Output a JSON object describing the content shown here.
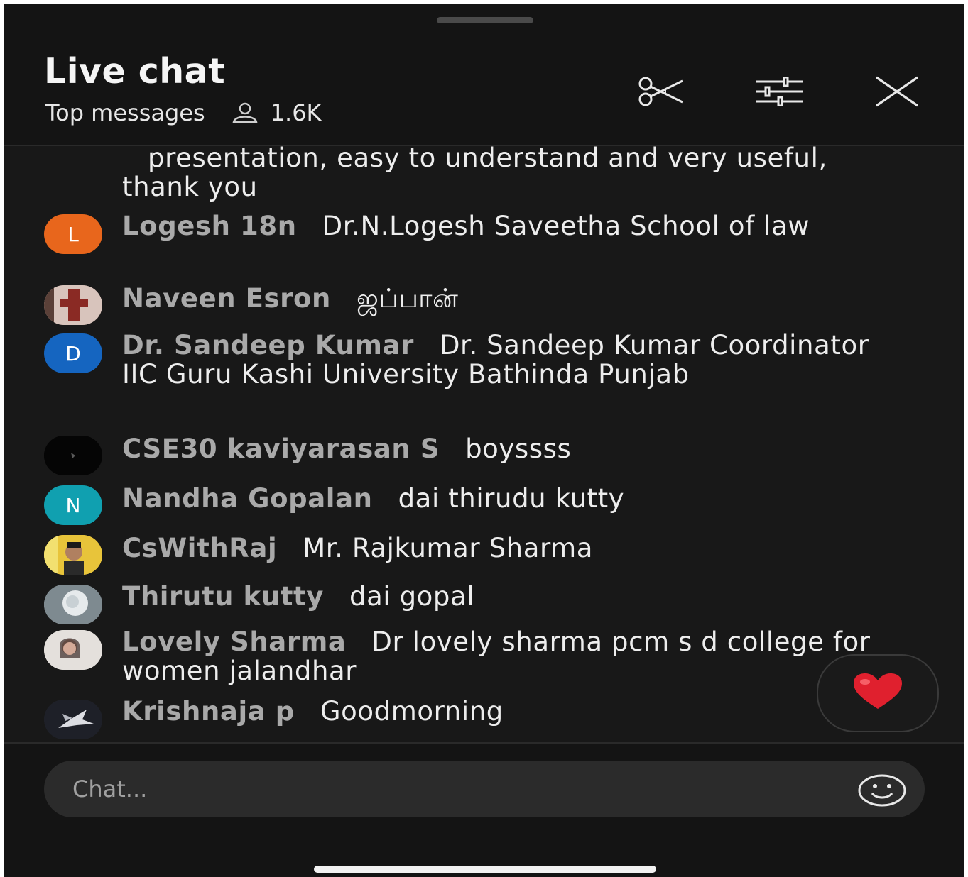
{
  "header": {
    "title": "Live chat",
    "subtitle": "Top messages",
    "viewer_count": "1.6K",
    "icons": [
      "scissors-icon",
      "filter-sliders-icon",
      "close-icon"
    ]
  },
  "messages": [
    {
      "author": "",
      "text": "presentation, easy to understand and very useful, thank you",
      "avatar": {
        "letter": "",
        "color": ""
      }
    },
    {
      "author": "Logesh 18n",
      "text": "Dr.N.Logesh Saveetha School of law",
      "avatar": {
        "letter": "L",
        "color": "#e8661c"
      }
    },
    {
      "author": "Naveen Esron",
      "text": "ஜப்பான்",
      "avatar": {
        "letter": "",
        "color": "#7a5a50"
      }
    },
    {
      "author": "Dr. Sandeep Kumar",
      "text": "Dr. Sandeep Kumar Coordinator IIC Guru Kashi University Bathinda Punjab",
      "avatar": {
        "letter": "D",
        "color": "#1565c0"
      }
    },
    {
      "author": "CSE30 kaviyarasan S",
      "text": "boyssss",
      "avatar": {
        "letter": "",
        "color": "#050505"
      }
    },
    {
      "author": "Nandha Gopalan",
      "text": "dai thirudu kutty",
      "avatar": {
        "letter": "N",
        "color": "#10a0b0"
      }
    },
    {
      "author": "CsWithRaj",
      "text": "Mr. Rajkumar Sharma",
      "avatar": {
        "letter": "",
        "color": "#d8b43a"
      }
    },
    {
      "author": "Thirutu kutty",
      "text": "dai gopal",
      "avatar": {
        "letter": "",
        "color": "#9aa4aa"
      }
    },
    {
      "author": "Lovely Sharma",
      "text": "Dr lovely sharma pcm s d college for women jalandhar",
      "avatar": {
        "letter": "",
        "color": "#cfcac4"
      }
    },
    {
      "author": "Krishnaja p",
      "text": "Goodmorning",
      "avatar": {
        "letter": "",
        "color": "#23252e"
      }
    }
  ],
  "reaction": {
    "icon": "heart-icon",
    "color": "#e0202e"
  },
  "composer": {
    "placeholder": "Chat...",
    "emoji_icon": "smiley-icon"
  },
  "colors": {
    "background": "#141414",
    "text": "#ededed",
    "author": "#a9a9a9",
    "input_bg": "#2b2b2b"
  }
}
